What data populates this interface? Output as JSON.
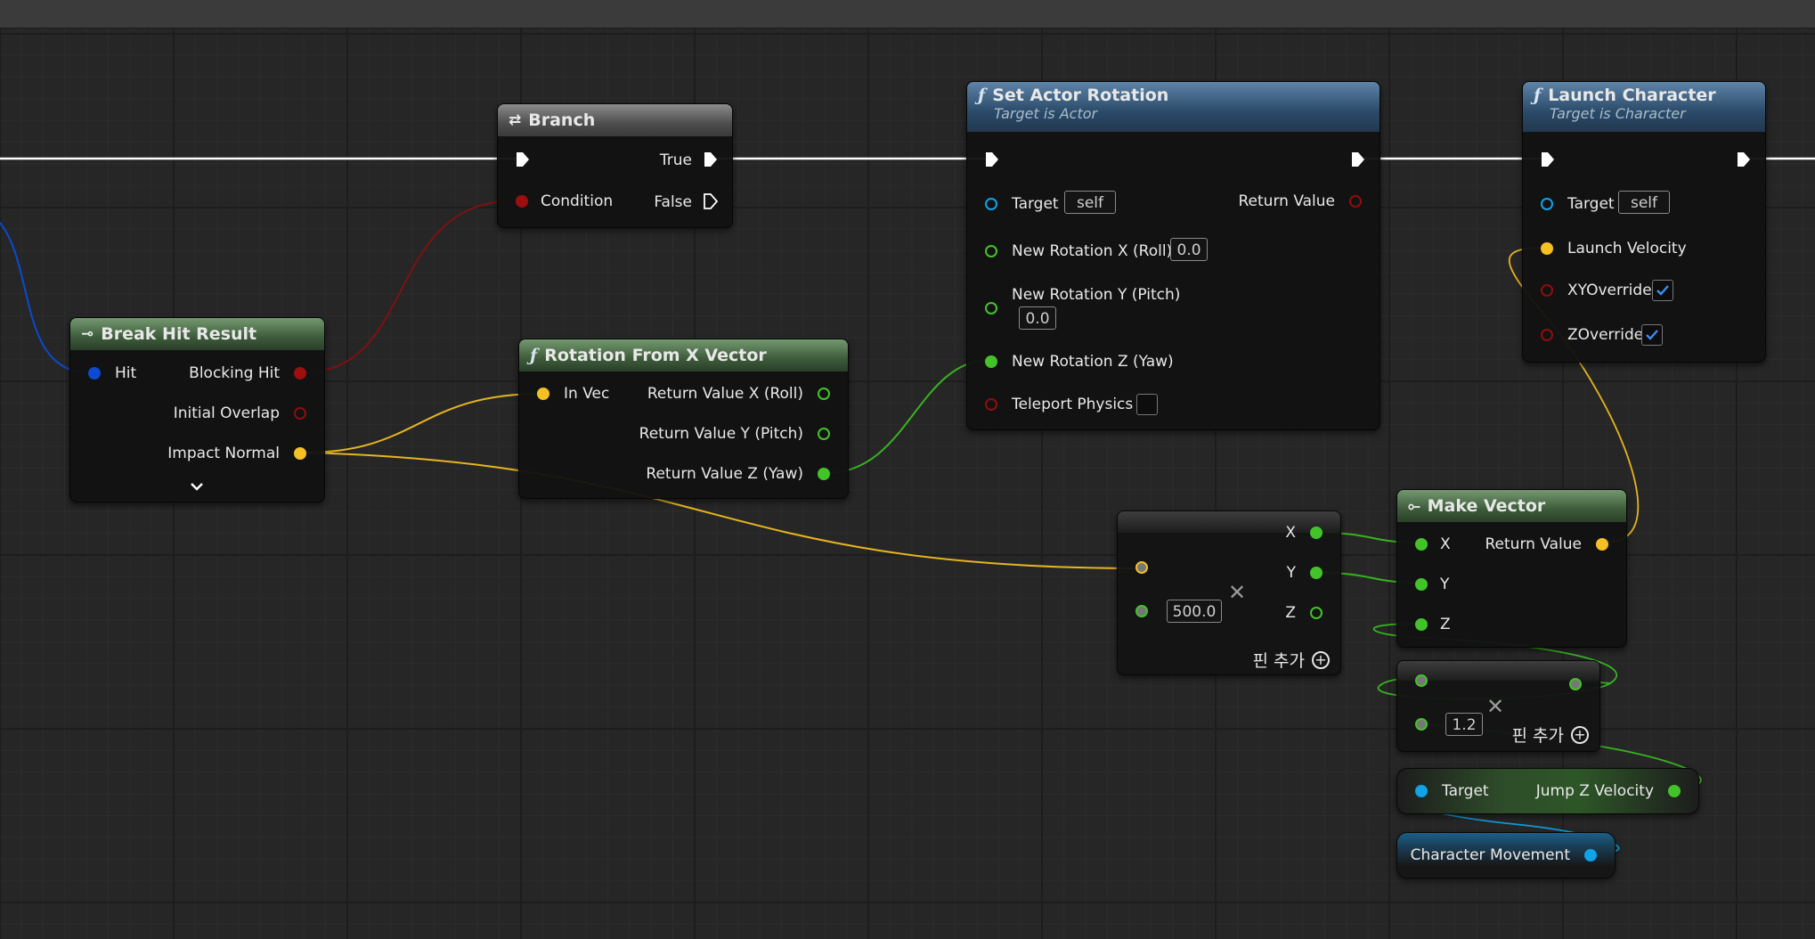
{
  "colors": {
    "exec": "#ffffff",
    "bool": "#8f0e0e",
    "struct_hit": "#0b4ad1",
    "vector": "#f5c024",
    "float": "#43c32a",
    "object": "#10a3e8",
    "func_header": "#2b4a69",
    "pure_header": "#3d5c3a"
  },
  "nodes": {
    "branch": {
      "title": "Branch",
      "icon": "branch-icon",
      "true_label": "True",
      "false_label": "False",
      "condition_label": "Condition"
    },
    "set_actor_rotation": {
      "title": "Set Actor Rotation",
      "subtitle": "Target is Actor",
      "target_label": "Target",
      "target_value": "self",
      "return_label": "Return Value",
      "roll_label": "New Rotation X (Roll)",
      "roll_value": "0.0",
      "pitch_label": "New Rotation Y (Pitch)",
      "pitch_value": "0.0",
      "yaw_label": "New Rotation Z (Yaw)",
      "teleport_label": "Teleport Physics",
      "teleport_checked": false
    },
    "launch_character": {
      "title": "Launch Character",
      "subtitle": "Target is Character",
      "target_label": "Target",
      "target_value": "self",
      "velocity_label": "Launch Velocity",
      "xy_label": "XYOverride",
      "xy_checked": true,
      "z_label": "ZOverride",
      "z_checked": true
    },
    "break_hit_result": {
      "title": "Break Hit Result",
      "hit_label": "Hit",
      "blocking_label": "Blocking Hit",
      "overlap_label": "Initial Overlap",
      "normal_label": "Impact Normal"
    },
    "rotation_from_x": {
      "title": "Rotation From X Vector",
      "invec_label": "In Vec",
      "roll_label": "Return Value X (Roll)",
      "pitch_label": "Return Value Y (Pitch)",
      "yaw_label": "Return Value Z (Yaw)"
    },
    "multiply_vector": {
      "value": "500.0",
      "x_label": "X",
      "y_label": "Y",
      "z_label": "Z",
      "add_pin_label": "핀 추가"
    },
    "make_vector": {
      "title": "Make Vector",
      "x_label": "X",
      "y_label": "Y",
      "z_label": "Z",
      "return_label": "Return Value"
    },
    "multiply_float": {
      "value": "1.2",
      "add_pin_label": "핀 추가"
    },
    "jump_z_velocity": {
      "target_label": "Target",
      "output_label": "Jump Z Velocity"
    },
    "character_movement": {
      "label": "Character Movement"
    }
  }
}
